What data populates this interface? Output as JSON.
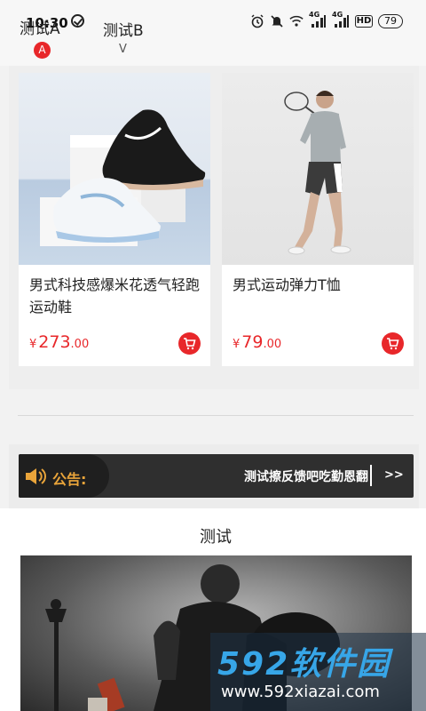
{
  "status_bar": {
    "time": "10:30",
    "battery": "79",
    "net_label_1": "4G",
    "net_label_2": "4G",
    "hd_label": "HD"
  },
  "tabs": {
    "tab_a": "测试A",
    "tab_a_badge": "A",
    "tab_b": "测试B",
    "tab_b_arrow": "V"
  },
  "products": [
    {
      "name": "男式科技感爆米花透气轻跑运动鞋",
      "currency": "¥",
      "price_int": "273",
      "price_dec": ".00",
      "image": "sneakers-photo"
    },
    {
      "name": "男式运动弹力T恤",
      "currency": "¥",
      "price_int": "79",
      "price_dec": ".00",
      "image": "man-in-sportswear-photo"
    }
  ],
  "notice": {
    "label": "公告:",
    "message": "测试擦反馈吧吃勤恩翻",
    "more": ">>"
  },
  "section": {
    "title": "测试",
    "banner_image": "black-and-white-street-photo"
  },
  "watermark": {
    "brand": "592软件园",
    "url": "www.592xiazai.com"
  },
  "colors": {
    "accent_red": "#e8272a",
    "notice_bg": "#2f2f2f",
    "notice_label": "#e9a43a",
    "watermark_blue": "#37a6e8"
  }
}
